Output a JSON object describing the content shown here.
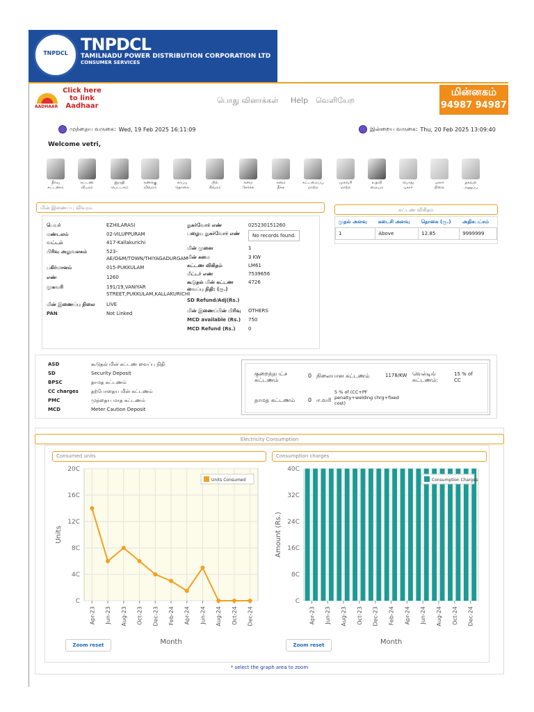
{
  "header": {
    "brand": "TNPDCL",
    "brand_sub": "TAMILNADU POWER DISTRIBUTION CORPORATION LTD",
    "brand_sub2": "CONSUMER SERVICES",
    "logo_text": "TNPDCL",
    "aadhaar_label": "AADHAAR",
    "aadhaar_link_l1": "Click here",
    "aadhaar_link_l2": "to link",
    "aadhaar_link_l3": "Aadhaar",
    "nav": [
      "பொது வினாக்கள்",
      "Help",
      "வெளியேற"
    ],
    "minnagam_title": "மின்னகம்",
    "minnagam_phone": "94987 94987"
  },
  "login": {
    "last_label": "முந்தைய வருகை:",
    "last_value": "Wed, 19 Feb 2025 16:11:09",
    "current_label": "இன்றைய வருகை:",
    "current_value": "Thu, 20 Feb 2025 13:09:40",
    "welcome": "Welcome vetri,"
  },
  "menu": [
    {
      "l1": "தீர்வு",
      "l2": "கட்டணம்",
      "color": "#7a7a7a"
    },
    {
      "l1": "கட்டண",
      "l2": "விபரம்",
      "color": "#5a5a5a"
    },
    {
      "l1": "இருதி",
      "l2": "பெட்டகம்",
      "color": "#6a6a6a"
    },
    {
      "l1": "கணக்கு",
      "l2": "விவரம்",
      "color": "#9a9a9a"
    },
    {
      "l1": "காப்பு",
      "l2": "தொகை",
      "color": "#8a8a8a"
    },
    {
      "l1": "பில்",
      "l2": "கிவரம்",
      "color": "#7a7a7a"
    },
    {
      "l1": "சுமை",
      "l2": "சேர்க்க",
      "color": "#5a5a5a"
    },
    {
      "l1": "சுமை",
      "l2": "நீக்க",
      "color": "#8a8a8a"
    },
    {
      "l1": "கட்டமைப்பு",
      "l2": "மாற்ற",
      "color": "#7a7a7a"
    },
    {
      "l1": "முகவரி",
      "l2": "மாற்ற",
      "color": "#9a9a9a"
    },
    {
      "l1": "உதவி",
      "l2": "மையம்",
      "color": "#4a4a4a"
    },
    {
      "l1": "பொது",
      "l2": "புகார்",
      "color": "#aaaaaa"
    },
    {
      "l1": "புகார்",
      "l2": "நிலை",
      "color": "#bbbbbb"
    },
    {
      "l1": "தகவல்",
      "l2": "அனுப்ப",
      "color": "#aaaaaa"
    }
  ],
  "consumer": {
    "panel_title": "மின் இணைப்பு விவரம்",
    "left": [
      {
        "label": "பெயர்",
        "value": "EZHILARASI"
      },
      {
        "label": "மண்டலம்",
        "value": "02-VILUPPURAM"
      },
      {
        "label": "வட்டம்",
        "value": "417-Kallakurichi"
      },
      {
        "label": "பிரிவு அலுவலகம்",
        "value": "523-AE/O&M/TOWN/THIYAGADURGAM"
      },
      {
        "label": "பகிர்மானம்",
        "value": "015-PUKKULAM"
      },
      {
        "label": "எண்",
        "value": "1260"
      },
      {
        "label": "முகவரி",
        "value": "191/19,VANIYAR STREET,PUKKULAM,KALLAKURICHI"
      },
      {
        "label": "மின் இணைப்பு நிலை",
        "value": "LIVE"
      },
      {
        "label": "PAN",
        "value": "Not Linked"
      }
    ],
    "right": [
      {
        "label": "நுகர்வோர் எண்",
        "value": "025230151260"
      },
      {
        "label": "பழைய நுகர்வோர் எண்",
        "value": "No records found."
      },
      {
        "label": "மின் முனை",
        "value": "1"
      },
      {
        "label": "மின் சுமை",
        "value": "3 KW"
      },
      {
        "label": "கட்டண விகிதம்",
        "value": "LM61"
      },
      {
        "label": "மீட்டர் எண்",
        "value": "7539656"
      },
      {
        "label": "கூடுதல் மின் கட்டண வைப்பு நிதி: (ரூ.)",
        "value": "4726"
      },
      {
        "label": "SD Refund/Adj(Rs.)",
        "value": ""
      },
      {
        "label": "மின் இணைப்பின் பிரிவு",
        "value": "OTHERS"
      },
      {
        "label": "MCD available (Rs.)",
        "value": "750"
      },
      {
        "label": "MCD Refund (Rs.)",
        "value": "0"
      }
    ]
  },
  "tariff": {
    "title": "கட்டண விகிதம்",
    "headers": [
      "முதல் அளவு",
      "கடைசி அளவு",
      "தொகை (ரூ.)",
      "அதிகபட்சம்"
    ],
    "row": [
      "1",
      "Above",
      "12.85",
      "9999999"
    ]
  },
  "abbreviations": [
    {
      "k": "ASD",
      "v": "கூடுதல் மின் கட்டண வைப்பு நிதி"
    },
    {
      "k": "SD",
      "v": "Security Deposit"
    },
    {
      "k": "BPSC",
      "v": "தாமத கட்டணம்"
    },
    {
      "k": "CC charges",
      "v": "தற்போதைய மின் கட்டணம்"
    },
    {
      "k": "PMC",
      "v": "முந்தைய மாத கட்டணம்"
    },
    {
      "k": "MCD",
      "v": "Meter Caution Deposit"
    }
  ],
  "charges_box": {
    "min_label": "குறைந்தபட்ச கட்டணம்",
    "min_value": "0",
    "fixed_label": "நிலையான கட்டணம்",
    "fixed_value": "1178/KW",
    "welding_label": "வெல்டிங் கட்டணம்:",
    "welding_value": "15 % of CC",
    "late_label": "தாமத கட்டணம்",
    "late_value": "0",
    "gst_label": "ஈ.வரி",
    "gst_value": "5 % of (CC+PF penalty+welding chrg+fixed cost)"
  },
  "electricity": {
    "title": "Electricity Consumption",
    "zoom_label": "Zoom reset",
    "note": "* select the graph area to zoom"
  },
  "chart_data": [
    {
      "type": "line",
      "panel_title": "Consumed units",
      "xlabel": "Month",
      "ylabel": "Units",
      "ylim": [
        0,
        200
      ],
      "yticks": [
        "20C",
        "16C",
        "12C",
        "8C",
        "4C",
        "C"
      ],
      "categories": [
        "Apr-23",
        "Jun-23",
        "Aug-23",
        "Oct-23",
        "Dec-23",
        "Feb-24",
        "Apr-24",
        "Jun-24",
        "Aug-24",
        "Oct-24",
        "Dec-24"
      ],
      "series": [
        {
          "name": "Units Consumed",
          "values": [
            140,
            60,
            80,
            60,
            40,
            30,
            15,
            50,
            0,
            0,
            0
          ],
          "color": "#f0a020"
        }
      ],
      "legend": "top-right",
      "grid": true
    },
    {
      "type": "bar",
      "panel_title": "Consumption charges",
      "xlabel": "Month",
      "ylabel": "Amount (Rs.)",
      "ylim": [
        0,
        400
      ],
      "yticks": [
        "40C",
        "32C",
        "24C",
        "16C",
        "8C",
        "C"
      ],
      "categories": [
        "Apr-23",
        "Jun-23",
        "Aug-23",
        "Oct-23",
        "Dec-23",
        "Feb-24",
        "Apr-24",
        "Jun-24",
        "Aug-24",
        "Oct-24",
        "Dec-24"
      ],
      "series": [
        {
          "name": "Consumption Charges",
          "values": [
            400,
            400,
            400,
            400,
            400,
            400,
            400,
            400,
            400,
            400,
            400,
            400,
            400,
            400,
            400,
            400,
            400,
            400,
            400,
            400,
            400,
            400
          ],
          "color": "#1a9a9a"
        }
      ],
      "legend": "top-right",
      "grid": true
    }
  ]
}
